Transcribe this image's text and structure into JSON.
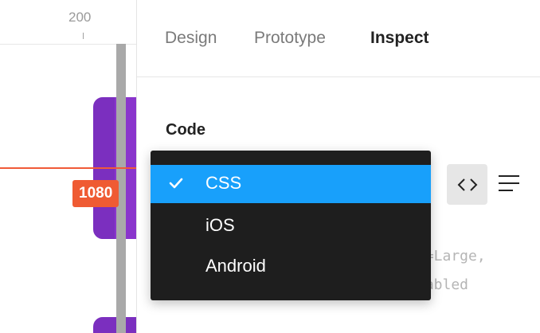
{
  "canvas": {
    "ruler_label": "200",
    "measurement": "1080"
  },
  "tabs": [
    {
      "label": "Design",
      "active": false
    },
    {
      "label": "Prototype",
      "active": false
    },
    {
      "label": "Inspect",
      "active": true
    }
  ],
  "section": {
    "title": "Code"
  },
  "dropdown": {
    "options": [
      {
        "label": "CSS",
        "selected": true
      },
      {
        "label": "iOS",
        "selected": false
      },
      {
        "label": "Android",
        "selected": false
      }
    ]
  },
  "code_preview": {
    "line_1": "e=Large,",
    "line_2": "nabled"
  },
  "icons": {
    "code_view": "code-brackets-icon",
    "text_view": "align-left-icon",
    "selected": "checkmark-icon"
  },
  "colors": {
    "selection": "#18a0fb",
    "dropdown_bg": "#1e1e1e",
    "measure_badge": "#ef5b33",
    "frame": "#7b2fbf"
  }
}
